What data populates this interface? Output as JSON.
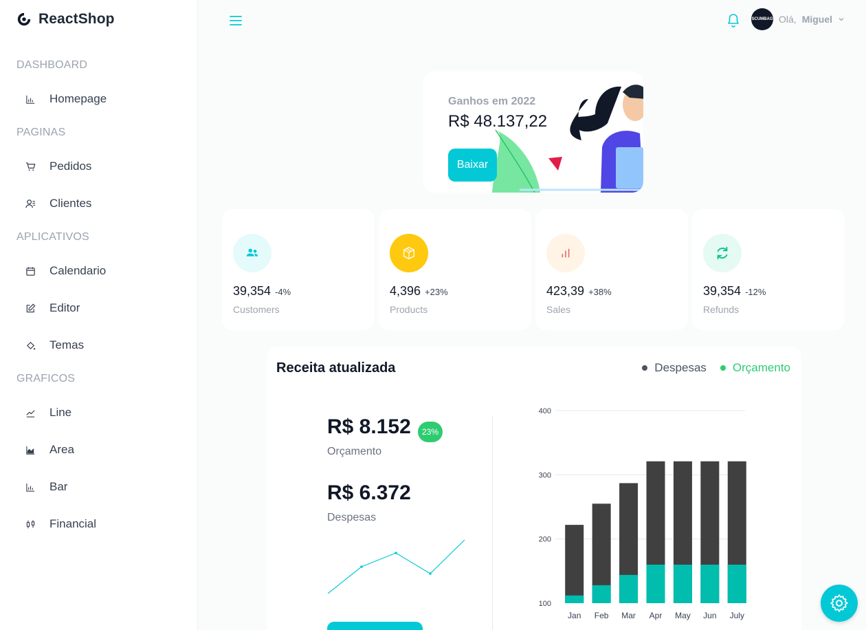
{
  "app": {
    "brand": "ReactShop"
  },
  "sidebar": {
    "sections": [
      {
        "title": "DASHBOARD"
      },
      {
        "title": "PAGINAS"
      },
      {
        "title": "APLICATIVOS"
      },
      {
        "title": "GRAFICOS"
      }
    ],
    "items": [
      {
        "label": "Homepage",
        "icon": "bar-chart-icon"
      },
      {
        "label": "Pedidos",
        "icon": "cart-icon"
      },
      {
        "label": "Clientes",
        "icon": "users-icon"
      },
      {
        "label": "Calendario",
        "icon": "calendar-icon"
      },
      {
        "label": "Editor",
        "icon": "edit-icon"
      },
      {
        "label": "Temas",
        "icon": "paint-bucket-icon"
      },
      {
        "label": "Line",
        "icon": "line-chart-icon"
      },
      {
        "label": "Area",
        "icon": "area-chart-icon"
      },
      {
        "label": "Bar",
        "icon": "bar-chart-icon"
      },
      {
        "label": "Financial",
        "icon": "candlestick-icon"
      }
    ]
  },
  "header": {
    "greeting": "Olá,",
    "username": "Miguel",
    "avatar_text": "SCUMBAG"
  },
  "earnings": {
    "title": "Ganhos em 2022",
    "value": "R$ 48.137,22",
    "button": "Baixar"
  },
  "stats": [
    {
      "value": "39,354",
      "change": "-4%",
      "label": "Customers",
      "icon": "users-icon",
      "bg": "#e5fafb",
      "fg": "#03c9d7"
    },
    {
      "value": "4,396",
      "change": "+23%",
      "label": "Products",
      "icon": "box-icon",
      "bg": "#fec90f",
      "fg": "#ffffff"
    },
    {
      "value": "423,39",
      "change": "+38%",
      "label": "Sales",
      "icon": "bar-chart-icon",
      "bg": "#fff4e5",
      "fg": "#e46a76"
    },
    {
      "value": "39,354",
      "change": "-12%",
      "label": "Refunds",
      "icon": "refresh-icon",
      "bg": "#e5faf2",
      "fg": "#00c292"
    }
  ],
  "revenue": {
    "title": "Receita atualizada",
    "legend": [
      {
        "label": "Despesas",
        "color": "#4b5563"
      },
      {
        "label": "Orçamento",
        "color": "#2ecc71"
      }
    ],
    "budget_value": "R$ 8.152",
    "budget_label": "Orçamento",
    "budget_badge": "23%",
    "expense_value": "R$ 6.372",
    "expense_label": "Despesas"
  },
  "chart_data": {
    "type": "bar",
    "stacked": true,
    "categories": [
      "Jan",
      "Feb",
      "Mar",
      "Apr",
      "May",
      "Jun",
      "July"
    ],
    "series": [
      {
        "name": "Orçamento",
        "color": "#00bdae",
        "values": [
          112,
          128,
          144,
          160,
          160,
          160,
          160
        ]
      },
      {
        "name": "Despesas",
        "color": "#404041",
        "values": [
          222,
          255,
          287,
          321,
          321,
          321,
          321
        ]
      }
    ],
    "yticks": [
      100,
      200,
      300,
      400
    ],
    "ylim": [
      100,
      400
    ]
  },
  "colors": {
    "accent": "#03c9d7"
  }
}
